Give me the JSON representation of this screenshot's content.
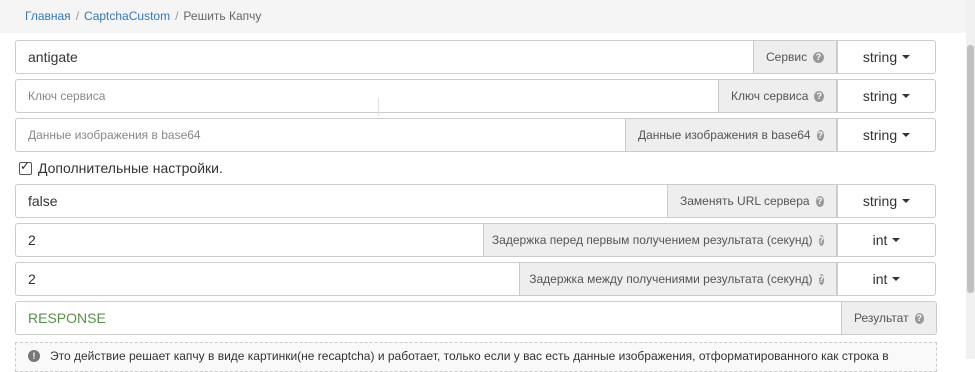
{
  "breadcrumb": {
    "home": "Главная",
    "section": "CaptchaCustom",
    "current": "Решить Капчу",
    "separator": "/"
  },
  "fields": [
    {
      "value": "antigate",
      "placeholder": "",
      "label": "Сервис",
      "type": "string"
    },
    {
      "value": "",
      "placeholder": "Ключ сервиса",
      "label": "Ключ сервиса",
      "type": "string"
    },
    {
      "value": "",
      "placeholder": "Данные изображения в base64",
      "label": "Данные изображения в base64",
      "type": "string"
    }
  ],
  "advanced": {
    "checkbox_label": "Дополнительные настройки.",
    "checked": true
  },
  "advanced_fields": [
    {
      "value": "false",
      "label": "Заменять URL сервера",
      "type": "string"
    },
    {
      "value": "2",
      "label": "Задержка перед первым получением результата (секунд)",
      "type": "int"
    },
    {
      "value": "2",
      "label": "Задержка между получениями результата (секунд)",
      "type": "int"
    }
  ],
  "result": {
    "value": "RESPONSE",
    "label": "Результат"
  },
  "note": {
    "text": "Это действие решает капчу в виде картинки(не recaptcha) и работает, только если у вас есть данные изображения, отформатированного как строка в"
  },
  "help_glyph": "?",
  "info_glyph": "!",
  "colors": {
    "link": "#337ab7",
    "result_text": "#5a8f4a",
    "addon_bg": "#eeeeee"
  }
}
